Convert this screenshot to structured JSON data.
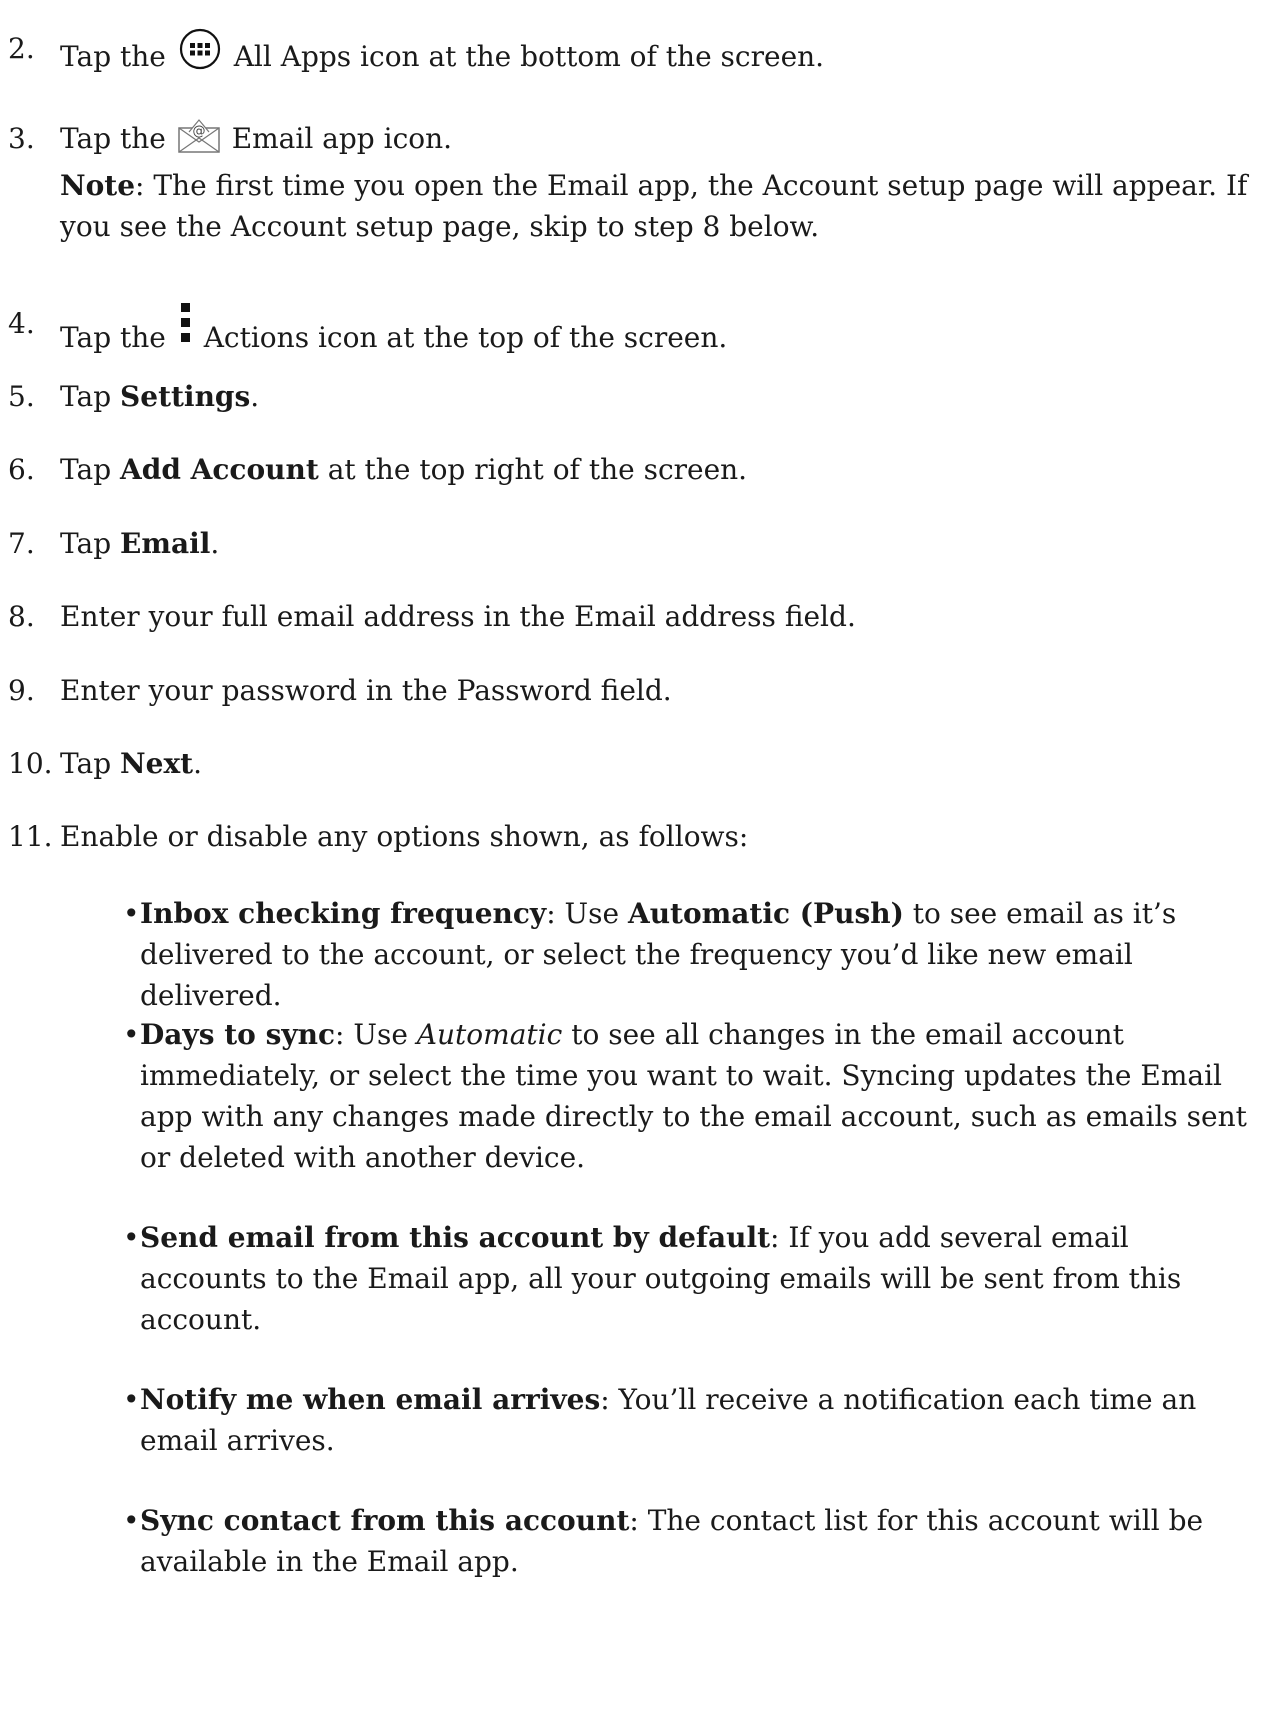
{
  "steps": [
    {
      "num": "2.",
      "pre": "Tap the",
      "icon": "all-apps-icon",
      "post": "All Apps icon at the bottom of the screen."
    },
    {
      "num": "3.",
      "pre": "Tap the",
      "icon": "email-app-icon",
      "post": "Email app icon.",
      "note_label": "Note",
      "note_text": ": The first time you open the Email app, the Account setup page will appear. If you see the Account setup page, skip to step 8 below."
    },
    {
      "num": "4.",
      "pre": "Tap the",
      "icon": "actions-icon",
      "post": "Actions icon at the top of the screen."
    },
    {
      "num": "5.",
      "pre": "Tap ",
      "bold": "Settings",
      "post": "."
    },
    {
      "num": "6.",
      "pre": "Tap ",
      "bold": "Add Account",
      "post": " at the top right of the screen."
    },
    {
      "num": "7.",
      "pre": "Tap ",
      "bold": "Email",
      "post": "."
    },
    {
      "num": "8.",
      "text": "Enter your full email address in the Email address field."
    },
    {
      "num": "9.",
      "text": "Enter your password in the Password field."
    },
    {
      "num": "10.",
      "pre": "Tap ",
      "bold": "Next",
      "post": "."
    },
    {
      "num": "11.",
      "text": "Enable or disable any options shown, as follows:"
    }
  ],
  "options": [
    {
      "bullet": "•",
      "bold": "Inbox checking frequency",
      "mid": ": Use ",
      "bold2": "Automatic (Push)",
      "rest": " to see email as it’s delivered to the account, or select the frequency you’d like new email delivered."
    },
    {
      "bullet": "•",
      "bold": "Days to sync",
      "mid": ": Use ",
      "italic": "Automatic",
      "rest": " to see all changes in the email account immediately, or select the time you want to wait. Syncing updates the Email app with any changes made directly to the email account, such as emails sent or deleted with another device."
    },
    {
      "bullet": "•",
      "bold": "Send email from this account by default",
      "rest": ": If you add several email accounts to the Email app, all your outgoing emails will be sent from this account."
    },
    {
      "bullet": "•",
      "bold": "Notify me when email arrives",
      "rest": ": You’ll receive a notification each time an email arrives."
    },
    {
      "bullet": "•",
      "bold": "Sync contact from this account",
      "rest": ": The contact list for this account will be available in the Email app."
    }
  ]
}
